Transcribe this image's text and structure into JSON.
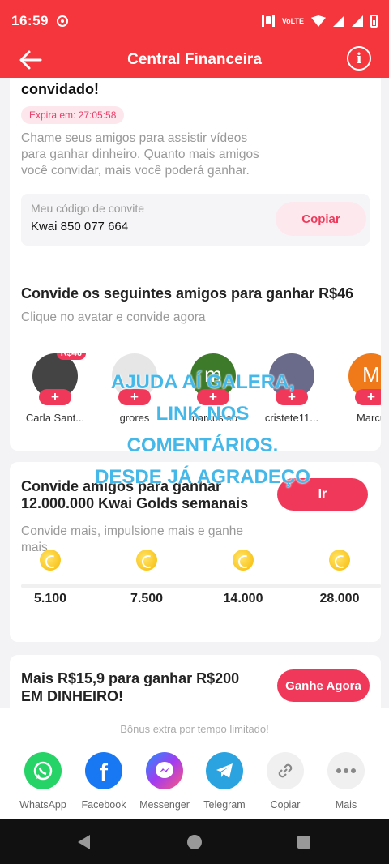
{
  "status": {
    "time": "16:59",
    "lte": "VoLTE"
  },
  "appbar": {
    "title": "Central Financeira",
    "info_glyph": "i"
  },
  "invite_card": {
    "heading": "convidado!",
    "expire": "Expira em: 27:05:58",
    "desc": "Chame seus amigos para assistir vídeos para ganhar dinheiro. Quanto mais amigos você convidar, mais você poderá ganhar.",
    "code_label": "Meu código de convite",
    "code": "Kwai 850 077 664",
    "copy": "Copiar"
  },
  "friends_card": {
    "title": "Convide os seguintes amigos para ganhar R$46",
    "subtitle": "Clique no avatar e convide agora",
    "plus": "+",
    "friends": [
      {
        "name": "Carla Sant...",
        "badge": "R$46",
        "color": "#444444",
        "initial": ""
      },
      {
        "name": "grores",
        "badge": "",
        "color": "#e6e6e6",
        "initial": ""
      },
      {
        "name": "marcus so",
        "badge": "",
        "color": "#3d7a2a",
        "initial": "m"
      },
      {
        "name": "cristete11...",
        "badge": "",
        "color": "#6a6a8a",
        "initial": ""
      },
      {
        "name": "Marcu",
        "badge": "",
        "color": "#f07a1a",
        "initial": "M"
      }
    ]
  },
  "golds_card": {
    "title": "Convide amigos para ganhar 12.000.000 Kwai Golds semanais",
    "subtitle": "Convide mais, impulsione mais e ganhe mais",
    "button": "Ir",
    "milestones": [
      "5.100",
      "7.500",
      "14.000",
      "28.000"
    ]
  },
  "cash_card": {
    "title": "Mais R$15,9 para ganhar R$200 EM DINHEIRO!",
    "button": "Ganhe Agora"
  },
  "overlay_text": [
    "AJUDA AÍ GALERA,",
    "LINK NOS",
    "COMENTÁRIOS.",
    "DESDE JÁ AGRADEÇO"
  ],
  "share_sheet": {
    "note": "Bônus extra por tempo limitado!",
    "items": [
      {
        "label": "WhatsApp",
        "icon": "whatsapp-icon",
        "color": "#25d366"
      },
      {
        "label": "Facebook",
        "icon": "facebook-icon",
        "color": "#1877f2"
      },
      {
        "label": "Messenger",
        "icon": "messenger-icon",
        "color": "#a33bf0"
      },
      {
        "label": "Telegram",
        "icon": "telegram-icon",
        "color": "#2aa3e0"
      },
      {
        "label": "Copiar",
        "icon": "link-icon",
        "color": "#f0f0f0"
      },
      {
        "label": "Mais",
        "icon": "more-icon",
        "color": "#f0f0f0"
      }
    ]
  }
}
